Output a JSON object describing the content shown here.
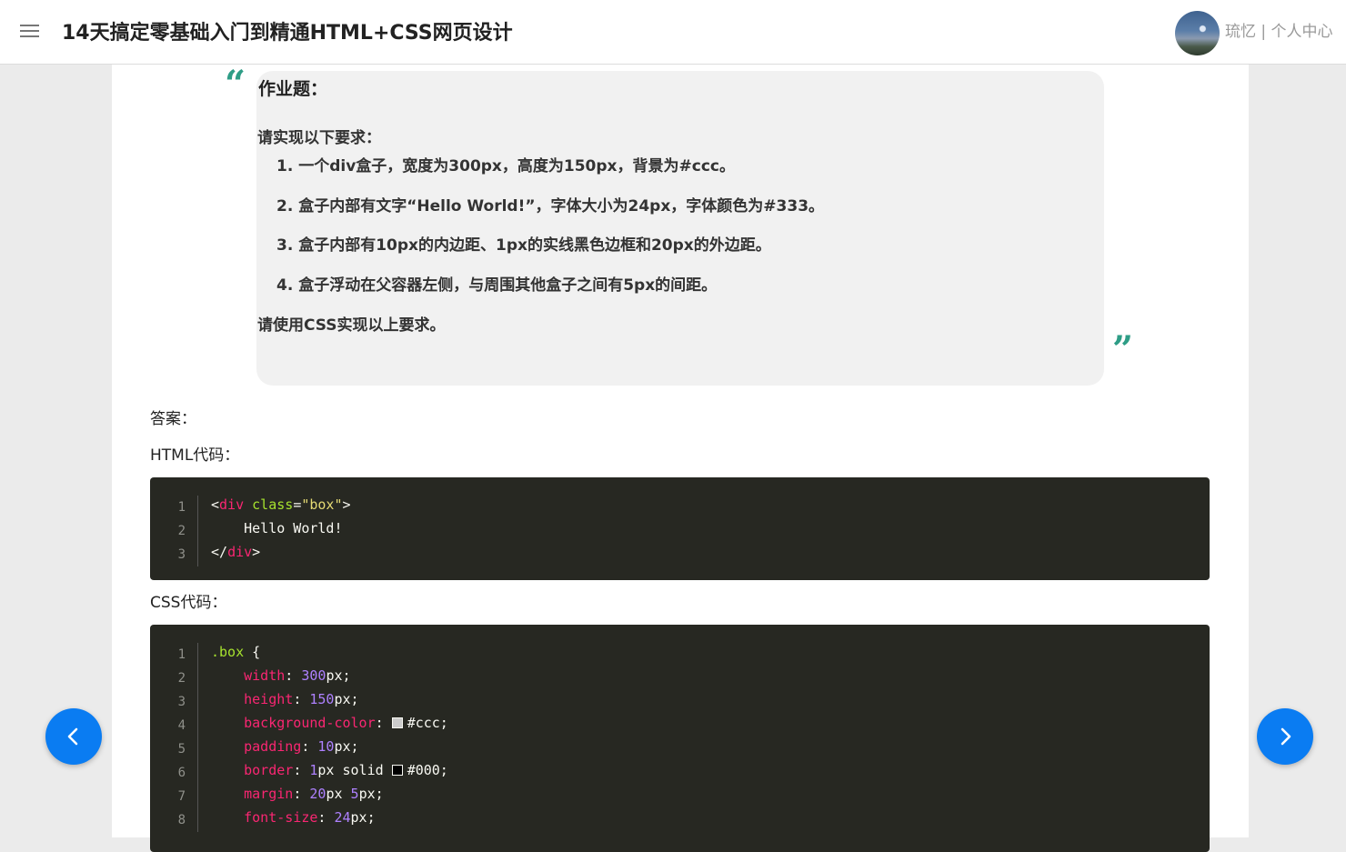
{
  "header": {
    "menu_icon": "hamburger-menu-icon",
    "title": "14天搞定零基础入门到精通HTML+CSS网页设计",
    "user_name": "琉忆",
    "separator": " | ",
    "user_center": "个人中心"
  },
  "quote": {
    "open_mark": "“",
    "close_mark": "”",
    "accent_color": "#2e9d86",
    "title": "作业题：",
    "intro": "请实现以下要求：",
    "items": [
      "1. 一个div盒子，宽度为300px，高度为150px，背景为#ccc。",
      "2. 盒子内部有文字“Hello World!”，字体大小为24px，字体颜色为#333。",
      "3. 盒子内部有10px的内边距、1px的实线黑色边框和20px的外边距。",
      "4. 盒子浮动在父容器左侧，与周围其他盒子之间有5px的间距。"
    ],
    "outro": "请使用CSS实现以上要求。"
  },
  "answer_label": "答案：",
  "html_label": "HTML代码：",
  "css_label": "CSS代码：",
  "html_code": {
    "line_numbers": [
      "1",
      "2",
      "3"
    ],
    "tag_open": "<",
    "tag_close": ">",
    "tag_end_open": "</",
    "tag_name": "div",
    "attr_name": "class",
    "equals": "=",
    "attr_value": "\"box\"",
    "text_line": "    Hello World!"
  },
  "css_code": {
    "line_numbers": [
      "1",
      "2",
      "3",
      "4",
      "5",
      "6",
      "7",
      "8"
    ],
    "selector": ".box",
    "brace": " {",
    "indent": "    ",
    "lines": [
      {
        "prop": "width",
        "parts": [
          {
            "t": "num",
            "v": "300"
          },
          {
            "t": "txt",
            "v": "px;"
          }
        ]
      },
      {
        "prop": "height",
        "parts": [
          {
            "t": "num",
            "v": "150"
          },
          {
            "t": "txt",
            "v": "px;"
          }
        ]
      },
      {
        "prop": "background-color",
        "swatch": "#cccccc",
        "parts": [
          {
            "t": "txt",
            "v": "#ccc;"
          }
        ]
      },
      {
        "prop": "padding",
        "parts": [
          {
            "t": "num",
            "v": "10"
          },
          {
            "t": "txt",
            "v": "px;"
          }
        ]
      },
      {
        "prop": "border",
        "parts": [
          {
            "t": "num",
            "v": "1"
          },
          {
            "t": "txt",
            "v": "px solid "
          }
        ],
        "swatch_after": "#000000",
        "tail": "#000;"
      },
      {
        "prop": "margin",
        "parts": [
          {
            "t": "num",
            "v": "20"
          },
          {
            "t": "txt",
            "v": "px "
          },
          {
            "t": "num",
            "v": "5"
          },
          {
            "t": "txt",
            "v": "px;"
          }
        ]
      },
      {
        "prop": "font-size",
        "parts": [
          {
            "t": "num",
            "v": "24"
          },
          {
            "t": "txt",
            "v": "px;"
          }
        ]
      }
    ],
    "colon": ": "
  },
  "nav": {
    "prev_icon": "chevron-left-icon",
    "next_icon": "chevron-right-icon",
    "button_color": "#0a7cf2"
  }
}
